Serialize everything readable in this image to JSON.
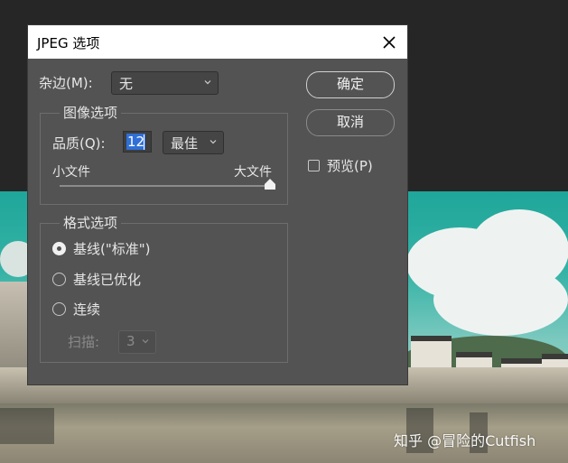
{
  "watermark": "知乎 @冒险的Cutfish",
  "dialog": {
    "title": "JPEG 选项",
    "matte_label": "杂边(M):",
    "matte_value": "无",
    "image_options": {
      "legend": "图像选项",
      "quality_label": "品质(Q):",
      "quality_value": "12",
      "quality_preset": "最佳",
      "small_file_label": "小文件",
      "large_file_label": "大文件",
      "quality_level_fraction": 1.0
    },
    "format_options": {
      "legend": "格式选项",
      "options": [
        "基线(\"标准\")",
        "基线已优化",
        "连续"
      ],
      "selected_index": 0,
      "scans_label": "扫描:",
      "scans_value": "3"
    },
    "ok_label": "确定",
    "cancel_label": "取消",
    "preview_label": "预览(P)",
    "preview_checked": false
  },
  "colors": {
    "dialog_bg": "#535353",
    "background": "#262626",
    "selection": "#2f6fd6"
  }
}
